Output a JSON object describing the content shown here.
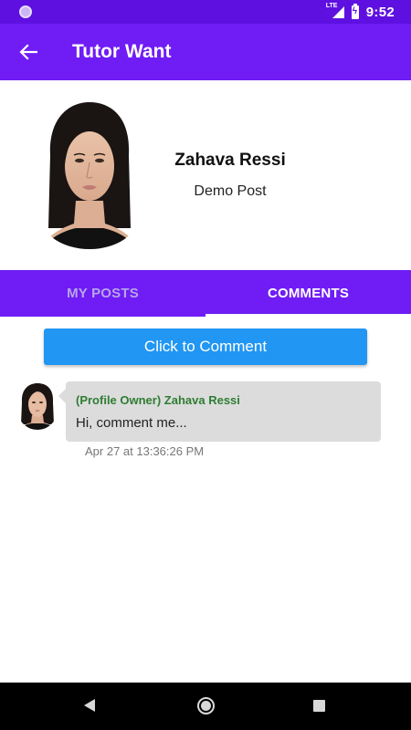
{
  "status_bar": {
    "time": "9:52",
    "network": "LTE",
    "icons": [
      "app-indicator-icon",
      "lte-signal-icon",
      "battery-charging-icon"
    ]
  },
  "app_bar": {
    "title": "Tutor Want",
    "back_icon": "arrow-left-icon"
  },
  "profile": {
    "name": "Zahava Ressi",
    "post": "Demo Post"
  },
  "tabs": [
    {
      "label": "MY POSTS",
      "active": false
    },
    {
      "label": "COMMENTS",
      "active": true
    }
  ],
  "comment_button": {
    "label": "Click to Comment"
  },
  "comments": [
    {
      "author": "(Profile Owner) Zahava Ressi",
      "text": "Hi, comment me...",
      "timestamp": "Apr 27 at 13:36:26 PM"
    }
  ],
  "colors": {
    "status_bar": "#5e10e0",
    "primary": "#6f1cf5",
    "button": "#2196f3",
    "author_green": "#2e7d32",
    "bubble": "#dcdcdc"
  },
  "nav_bar": {
    "icons": [
      "nav-back-icon",
      "nav-home-icon",
      "nav-recents-icon"
    ]
  }
}
